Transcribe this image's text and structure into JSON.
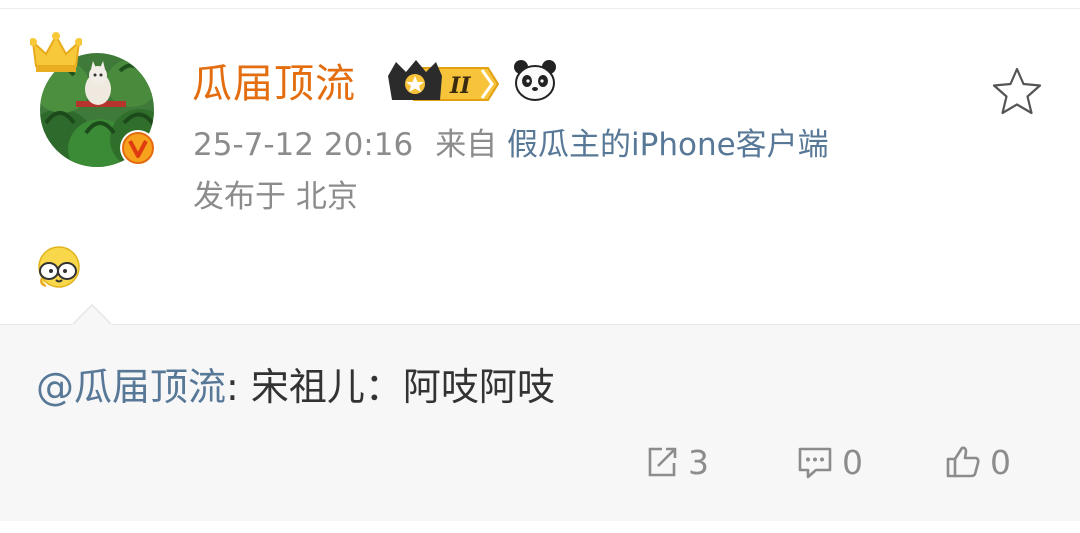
{
  "post": {
    "username": "瓜届顶流",
    "vip_level": "II",
    "timestamp": "25-7-12 20:16",
    "source_prefix": "来自",
    "source_app": "假瓜主的iPhone客户端",
    "location": "发布于 北京"
  },
  "repost": {
    "mention": "@瓜届顶流",
    "text": ": 宋祖儿：阿吱阿吱"
  },
  "actions": {
    "forward_count": "3",
    "comment_count": "0",
    "like_count": "0"
  },
  "colors": {
    "username": "#e36d0f",
    "link": "#587897",
    "meta": "#8c8c8c",
    "repost_bg": "#f7f7f7"
  },
  "icons": [
    "crown-icon",
    "verified-icon",
    "vip-badge-icon",
    "panda-icon",
    "star-icon",
    "emoji-icon",
    "forward-icon",
    "comment-icon",
    "like-icon"
  ]
}
